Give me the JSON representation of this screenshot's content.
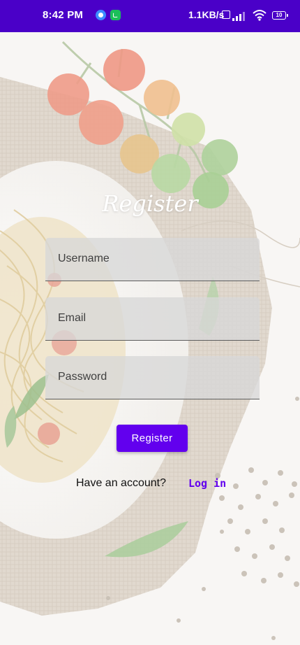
{
  "status_bar": {
    "time": "8:42 PM",
    "net_speed": "1.1KB/s",
    "battery": "10",
    "icons": [
      "messenger-icon",
      "phone-app-icon",
      "volte-icon",
      "signal-icon",
      "wifi-icon",
      "battery-icon"
    ]
  },
  "title": "Register",
  "form": {
    "username_placeholder": "Username",
    "email_placeholder": "Email",
    "password_placeholder": "Password",
    "register_label": "Register"
  },
  "footer": {
    "have_account": "Have an account?",
    "login_label": "Log in"
  },
  "colors": {
    "status_bar": "#4a00c8",
    "accent": "#6200ee"
  }
}
